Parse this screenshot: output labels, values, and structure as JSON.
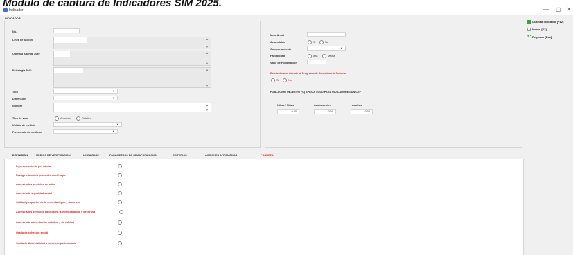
{
  "caption": "Modulo de captura de Indicadores SIM  2025.",
  "window": {
    "title": "Indicador",
    "minimize": "—",
    "maximize": "▢",
    "close": "✕"
  },
  "group_title": "INDICADOR",
  "left": {
    "no_label": "No.",
    "linea_label": "Linea de Acción",
    "objetivo_label": "Objetivo Agenda 2030",
    "estrategia_label": "Estrategia PND",
    "tipo_label": "Tipo",
    "dimension_label": "Dimension",
    "nombre_label": "Nombre",
    "tipo_valor_label": "Tipo de valor",
    "absoluto": "Absoluto",
    "relativo": "Relativo",
    "unidad_label": "Unidad de medida",
    "frecuencia_label": "Frecuencia de medicion"
  },
  "right": {
    "meta_label": "Meta Anual",
    "acumulable_label": "Acumulable",
    "si": "Si",
    "no": "No",
    "comportamiento_label": "Comportamiento",
    "factibilidad_label": "Factibilidad",
    "alta": "Alta",
    "media": "Media",
    "ponderacion_label": "Valor de Ponderacion",
    "atiende_text": "Este indicador atiende al Programa de Atención a la Pobreza",
    "si2": "Si",
    "no2": "No",
    "poblacion_title": "POBLACION OBJETIVO (%) APLICA SOLO PARA INDICADORES UNICEF",
    "ninos_label": "Niños / Niñas",
    "adolescentes_label": "Adolescentes",
    "adultos_label": "Adultos",
    "ninos_val": "0.00",
    "adolescentes_val": "0.00",
    "adultos_val": "0.00"
  },
  "tabs": [
    "DEFINICION",
    "MEDIOS DE VERIFICACION",
    "LINEA BASE",
    "PARAMETROS DE SEMAFORIZACION",
    "CRITERIOS",
    "ACCIONES AFIRMATIVAS",
    "POBREZA"
  ],
  "pobreza_items": [
    "Ingreso corriente per cápita",
    "Rezago educativo promedio en el hogar",
    "Acceso a los servicios de salud",
    "Acceso a la seguridad social",
    "Calidad y espacios de la vivienda digna y decorosa",
    "Acceso a los servicios básicos en la vivienda digna y decorosa",
    "Acceso a la alimentación nutritiva y de calidad",
    "Grado de cohesion social",
    "Grado de Accesibilidad a carretera pavimentada"
  ],
  "sidebar": {
    "guardar": "Guardar Indicador [F12]",
    "nuevo": "Nuevo [F2]",
    "regresar": "Regresar [Esc]"
  },
  "colors": {
    "accent_red": "#e02020",
    "save_green": "#3aa23a",
    "title_blue": "#3a6fd8"
  }
}
